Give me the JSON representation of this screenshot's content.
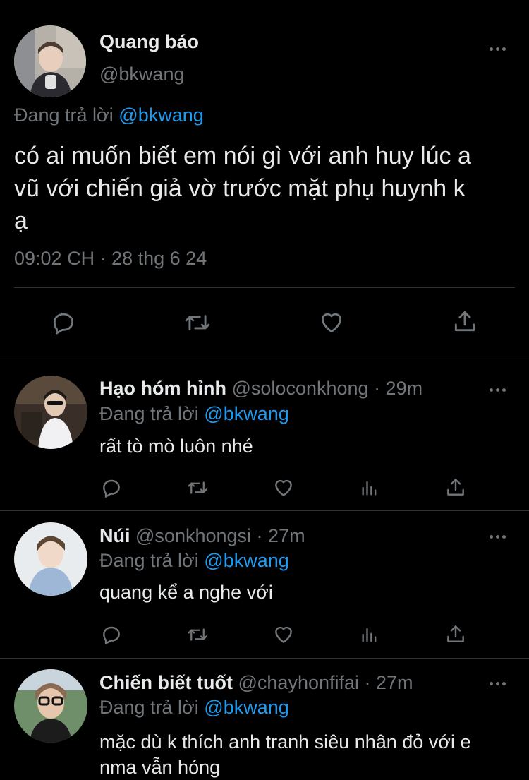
{
  "main_tweet": {
    "display_name": "Quang báo",
    "handle": "@bkwang",
    "replying_to_label": "Đang trả lời",
    "replying_to_handle": "@bkwang",
    "text_lines": [
      "có ai muốn biết em nói gì với anh huy lúc a",
      "vũ với chiến giả vờ trước mặt phụ huynh k",
      "ạ"
    ],
    "timestamp": "09:02 CH · 28 thg 6 24",
    "actions": [
      "reply-icon",
      "retweet-icon",
      "like-icon",
      "share-icon"
    ]
  },
  "replies": [
    {
      "display_name": "Hạo hóm hỉnh",
      "handle": "@soloconkhong",
      "time": "· 29m",
      "replying_to_label": "Đang trả lời",
      "replying_to_handle": "@bkwang",
      "text_lines": [
        "rất tò mò luôn nhé"
      ]
    },
    {
      "display_name": "Núi",
      "handle": "@sonkhongsi",
      "time": "· 27m",
      "replying_to_label": "Đang trả lời",
      "replying_to_handle": "@bkwang",
      "text_lines": [
        "quang kể a nghe với"
      ]
    },
    {
      "display_name": "Chiến biết tuốt",
      "handle": "@chayhonfifai",
      "time": "· 27m",
      "replying_to_label": "Đang trả lời",
      "replying_to_handle": "@bkwang",
      "text_lines": [
        "mặc dù k thích anh tranh siêu nhân đỏ với e",
        "nma vẫn hóng"
      ]
    }
  ],
  "colors": {
    "background": "#000000",
    "text": "#e7e9ea",
    "secondary": "#71767b",
    "accent": "#1d9bf0",
    "divider": "#2f3336"
  }
}
